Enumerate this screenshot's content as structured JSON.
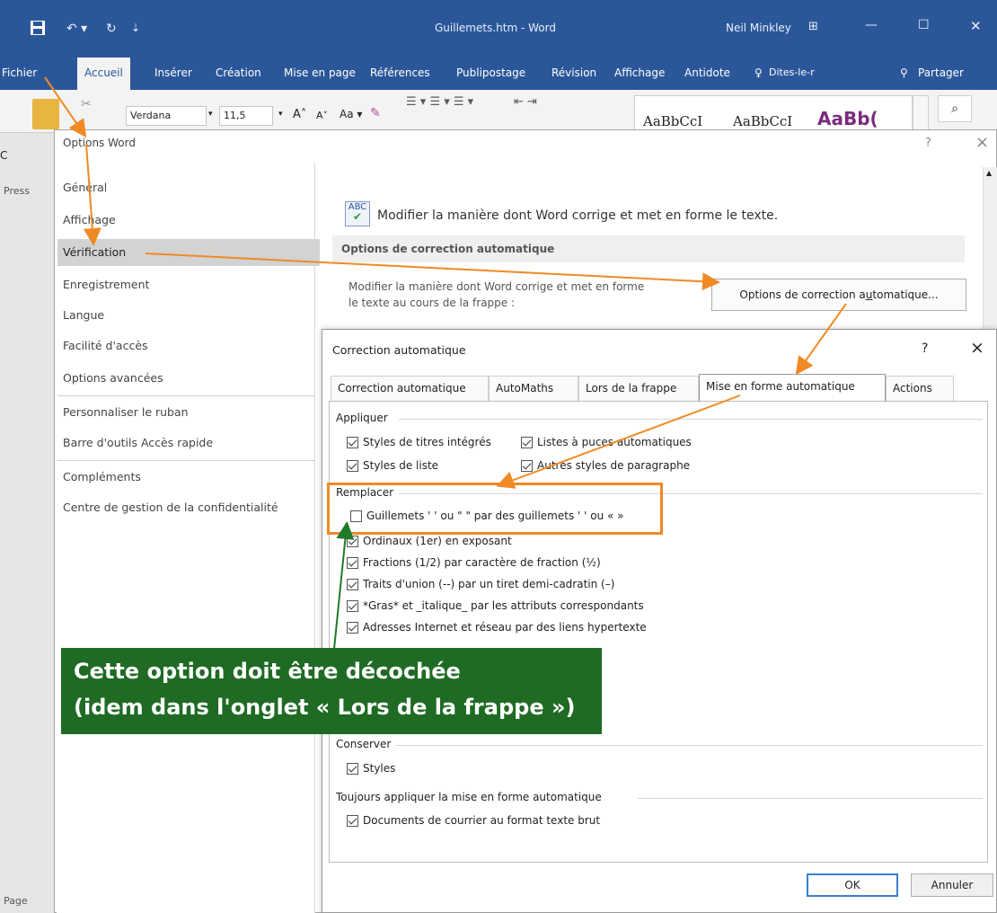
{
  "word": {
    "doc_title": "Guillemets.htm - Word",
    "user": "Neil Minkley",
    "tabs": [
      "Fichier",
      "Accueil",
      "Insérer",
      "Création",
      "Mise en page",
      "Références",
      "Publipostage",
      "Révision",
      "Affichage",
      "Antidote"
    ],
    "tell_me": "Dites-le-r",
    "share": "Partager",
    "font_name": "Verdana",
    "font_size": "11,5",
    "style1": "AaBbCcI",
    "style2": "AaBbCcI",
    "style3": "AaBb(",
    "left_labels": [
      "C",
      "Press",
      "Page"
    ]
  },
  "options_dialog": {
    "title": "Options Word",
    "help": "?",
    "close": "×",
    "nav": [
      "Général",
      "Affichage",
      "Vérification",
      "Enregistrement",
      "Langue",
      "Facilité d'accès",
      "Options avancées",
      "Personnaliser le ruban",
      "Barre d'outils Accès rapide",
      "Compléments",
      "Centre de gestion de la confidentialité"
    ],
    "selected": "Vérification",
    "header_text": "Modifier la manière dont Word corrige et met en forme le texte.",
    "icon_text": "ABC",
    "section": "Options de correction automatique",
    "desc_line1": "Modifier la manière dont Word corrige et met en forme",
    "desc_line2": "le texte au cours de la frappe :",
    "button_pre": "Options de correction a",
    "button_u": "u",
    "button_post": "tomatique..."
  },
  "ac_dialog": {
    "title": "Correction automatique",
    "help": "?",
    "close": "×",
    "tabs": [
      "Correction automatique",
      "AutoMaths",
      "Lors de la frappe",
      "Mise en forme automatique",
      "Actions"
    ],
    "active_tab": "Mise en forme automatique",
    "appliquer": "Appliquer",
    "appliquer_items": [
      {
        "label": "Styles de titres intégrés",
        "checked": true
      },
      {
        "label": "Listes à puces automatiques",
        "checked": true
      },
      {
        "label": "Styles de liste",
        "checked": true
      },
      {
        "label": "Autres styles de paragraphe",
        "checked": true
      }
    ],
    "remplacer": "Remplacer",
    "remplacer_items": [
      {
        "label": "Guillemets ' ' ou \" \" par des guillemets ' ' ou « »",
        "checked": false
      },
      {
        "label": "Ordinaux (1er) en exposant",
        "checked": true
      },
      {
        "label": "Fractions (1/2) par caractère de fraction (½)",
        "checked": true
      },
      {
        "label": "Traits d'union (--) par un tiret demi-cadratin (–)",
        "checked": true
      },
      {
        "label": "*Gras* et _italique_ par les attributs correspondants",
        "checked": true
      },
      {
        "label": "Adresses Internet et réseau par des liens hypertexte",
        "checked": true
      }
    ],
    "conserver": "Conserver",
    "conserver_items": [
      {
        "label": "Styles",
        "checked": true
      }
    ],
    "toujours": "Toujours appliquer la mise en forme automatique",
    "toujours_items": [
      {
        "label": "Documents de courrier au format texte brut",
        "checked": true
      }
    ],
    "ok": "OK",
    "cancel": "Annuler"
  },
  "annotation": {
    "line1": "Cette option doit être décochée",
    "line2": "(idem dans l'onglet « Lors de la frappe »)"
  },
  "colors": {
    "word_blue": "#2b579a",
    "arrow_orange": "#f08a24",
    "arrow_green": "#1f7a2a",
    "note_green": "#1f6b24"
  }
}
